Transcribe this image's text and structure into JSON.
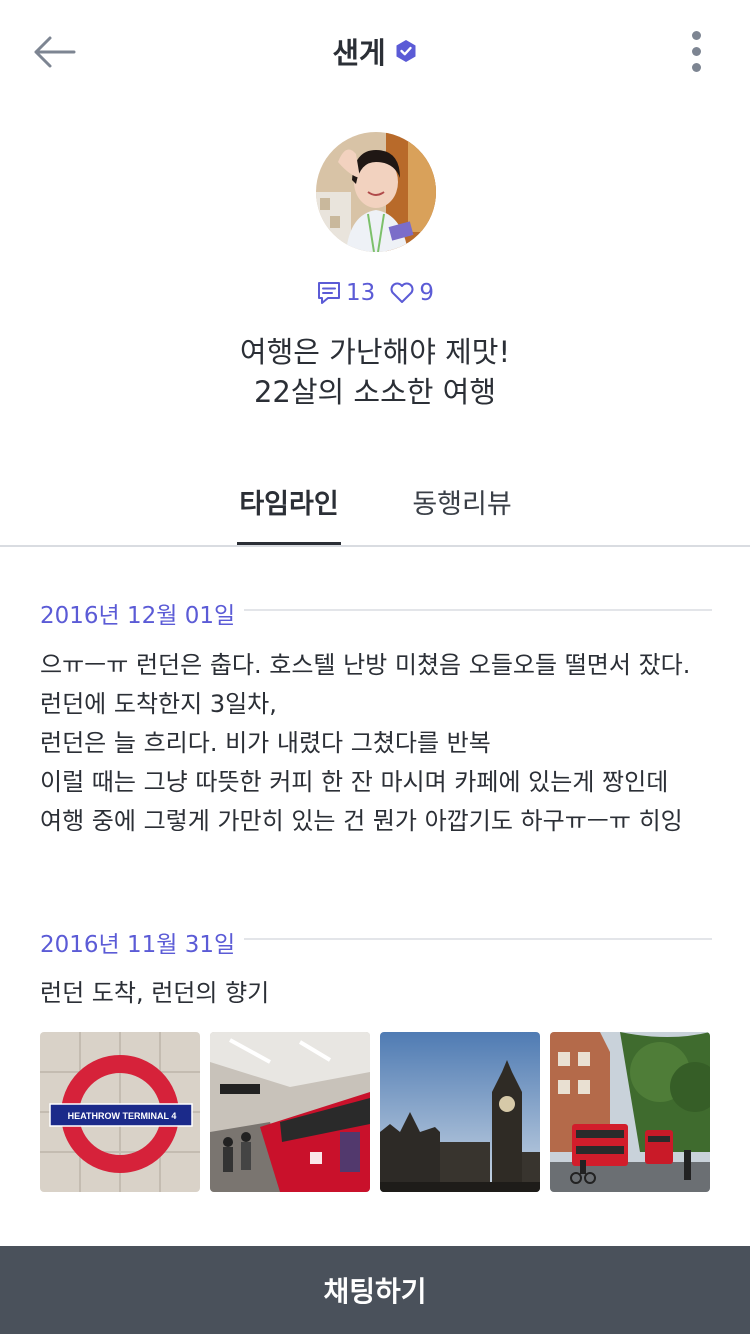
{
  "header": {
    "title": "샌게",
    "back_icon": "arrow-left-icon",
    "more_icon": "more-vertical-icon",
    "verified_icon": "verified-badge-icon"
  },
  "profile": {
    "avatar_icon": "avatar",
    "comments_count": "13",
    "likes_count": "9",
    "bio_line1": "여행은 가난해야 제맛!",
    "bio_line2": "22살의 소소한 여행"
  },
  "tabs": [
    {
      "label": "타임라인",
      "active": true
    },
    {
      "label": "동행리뷰",
      "active": false
    }
  ],
  "timeline": [
    {
      "date": "2016년 12월 01일",
      "text": "으ㅠㅡㅠ 런던은 춥다. 호스텔 난방 미쳤음 오들오들 떨면서 잤다.\n런던에 도착한지 3일차,\n런던은 늘 흐리다. 비가 내렸다 그쳤다를 반복\n이럴 때는 그냥 따뜻한 커피 한 잔 마시며 카페에 있는게 짱인데\n여행 중에 그렇게 가만히 있는 건 뭔가 아깝기도 하구ㅠㅡㅠ 히잉"
    },
    {
      "date": "2016년 11월 31일",
      "text": "런던 도착, 런던의 향기",
      "photos": [
        {
          "name": "heathrow-sign-photo",
          "sign_text": "HEATHROW  TERMINAL  4"
        },
        {
          "name": "underground-train-photo"
        },
        {
          "name": "big-ben-photo"
        },
        {
          "name": "london-street-bus-photo"
        }
      ]
    }
  ],
  "chat_button": {
    "label": "채팅하기"
  },
  "colors": {
    "accent": "#5b5bd6",
    "text": "#2b2f36",
    "divider": "#e3e5e9",
    "bottom_bar": "#4a515b"
  }
}
